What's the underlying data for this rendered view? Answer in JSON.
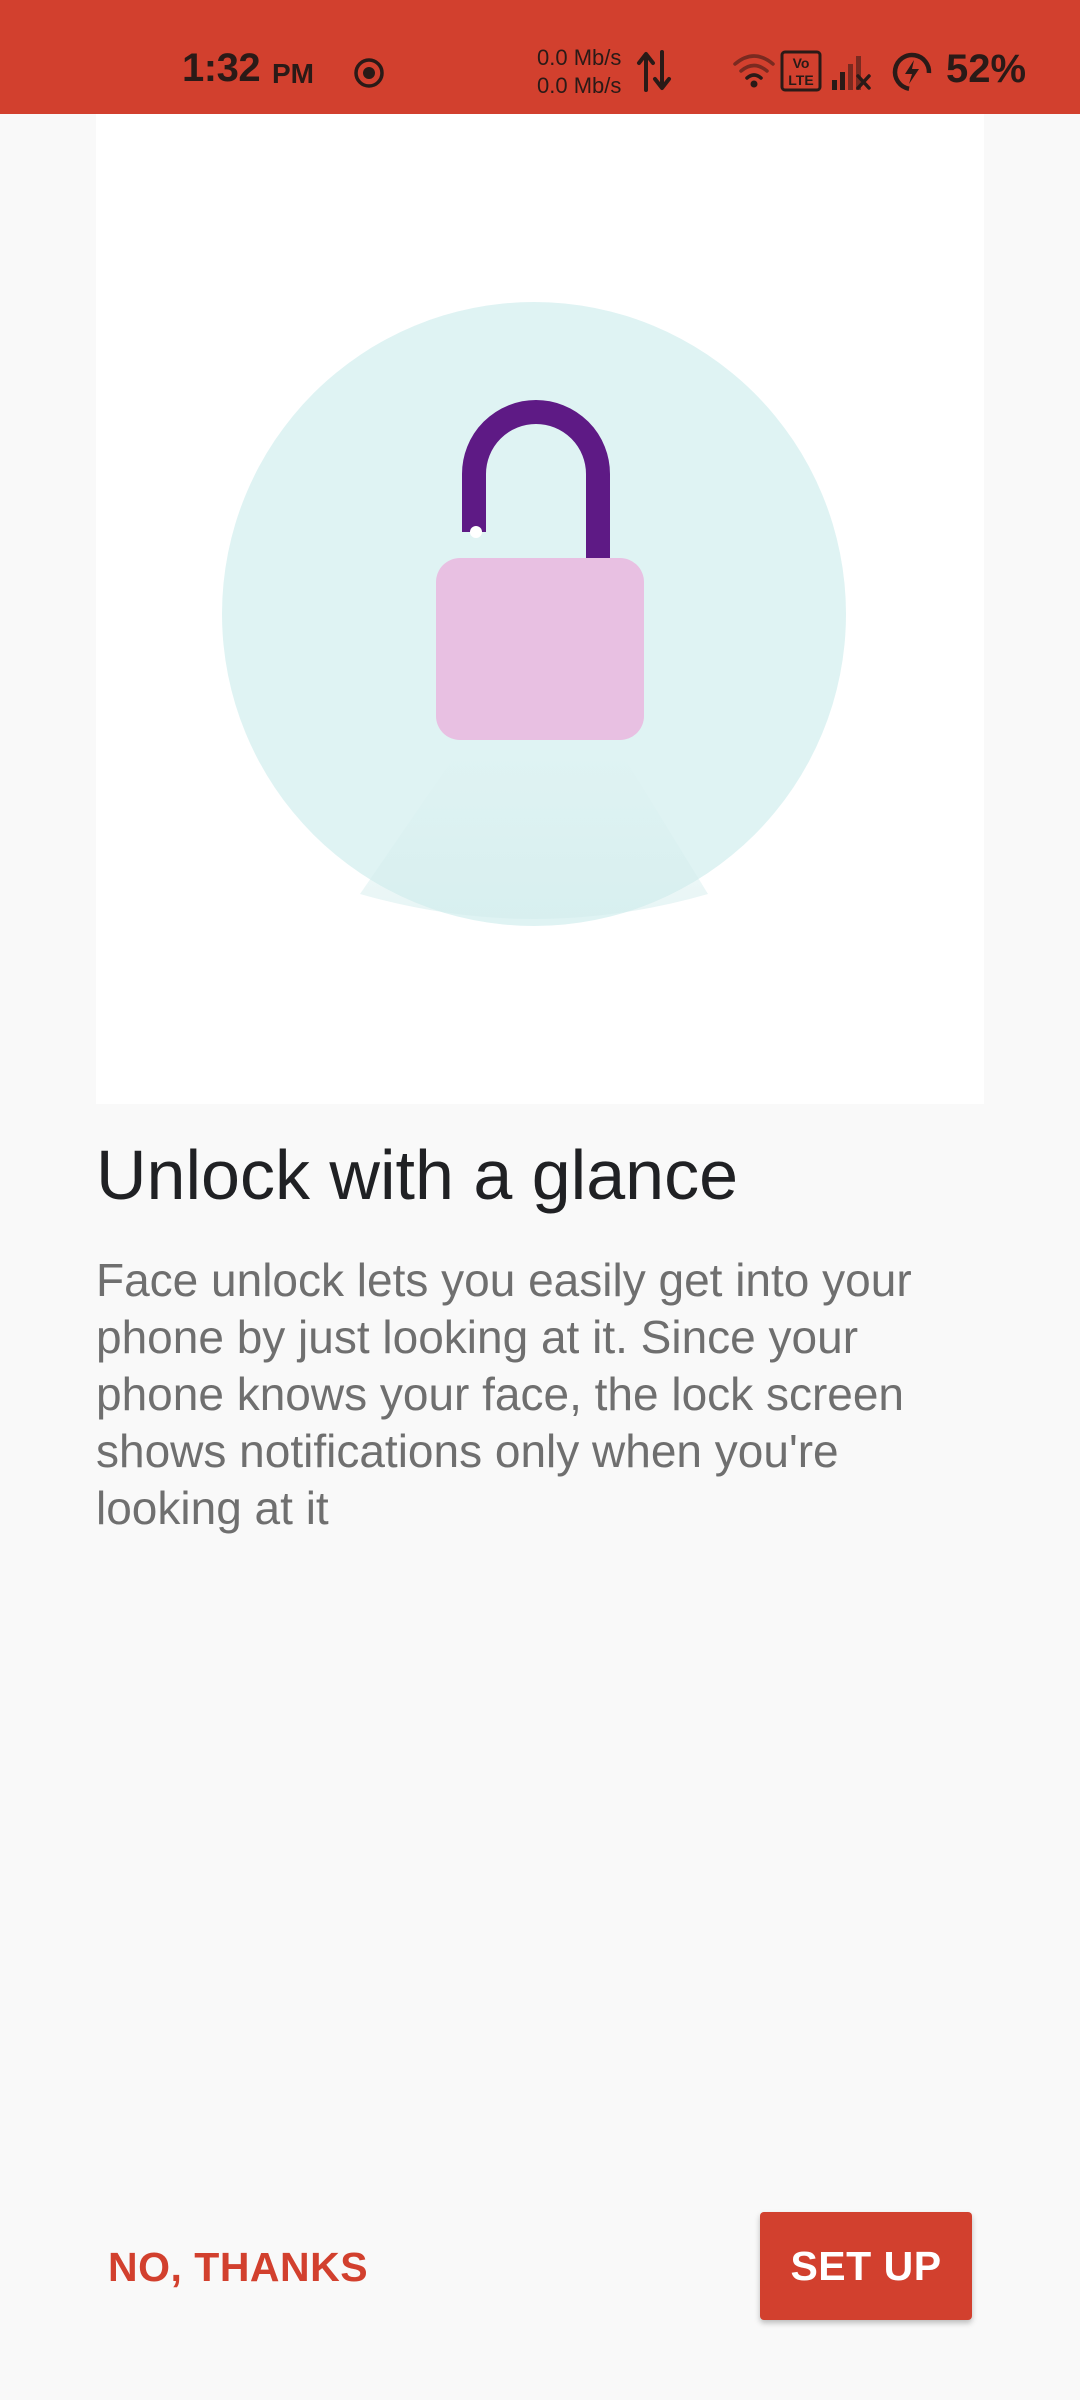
{
  "status_bar": {
    "time": "1:32",
    "ampm": "PM",
    "net_up": "0.0 Mb/s",
    "net_down": "0.0 Mb/s",
    "battery_percent": "52%",
    "volte_label": "Vo LTE",
    "icons": [
      "screen-record-icon",
      "data-arrows-icon",
      "wifi-icon",
      "volte-icon",
      "signal-icon",
      "battery-saver-icon"
    ],
    "background_color": "#d2402e"
  },
  "illustration": {
    "icon": "unlocked-padlock-icon",
    "circle_color": "#dff3f3",
    "shackle_color": "#5e1a85",
    "body_color": "#e8c0e2"
  },
  "content": {
    "title": "Unlock with a glance",
    "description": "Face unlock lets you easily get into your phone by just looking at it. Since your phone knows your face, the lock screen shows notifications only when you're looking at it"
  },
  "actions": {
    "secondary_label": "NO, THANKS",
    "primary_label": "SET UP",
    "accent_color": "#d2402e"
  }
}
